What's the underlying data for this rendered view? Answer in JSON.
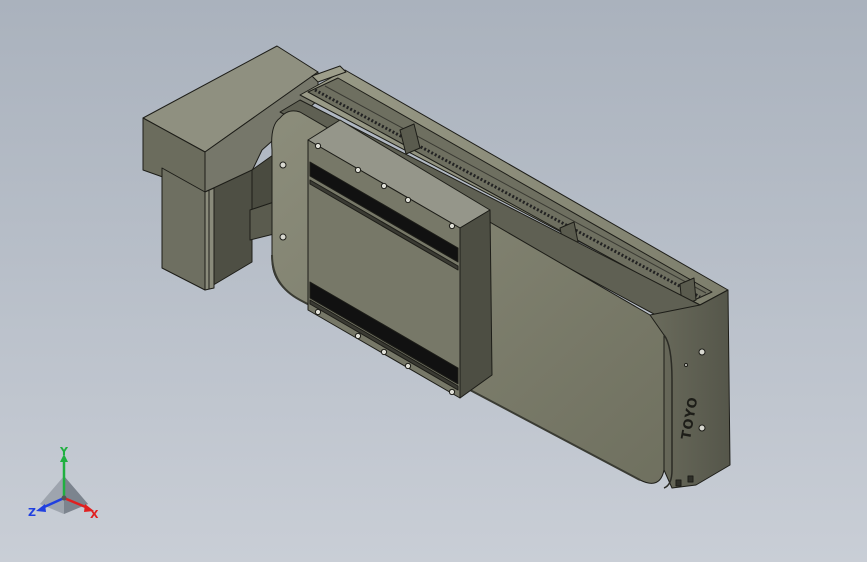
{
  "viewport": {
    "background_top": "#aab2bd",
    "background_bottom": "#c9ced6"
  },
  "model": {
    "body_color": "#7f806f",
    "side_color": "#5a5b4e",
    "dark_color": "#2e2e28",
    "edge_color": "#1d1d18",
    "stripe_color": "#111111",
    "logo_text": "TOYO"
  },
  "triad": {
    "x_label": "X",
    "y_label": "Y",
    "z_label": "Z",
    "x_color": "#e02020",
    "y_color": "#20b040",
    "z_color": "#2040e0"
  }
}
